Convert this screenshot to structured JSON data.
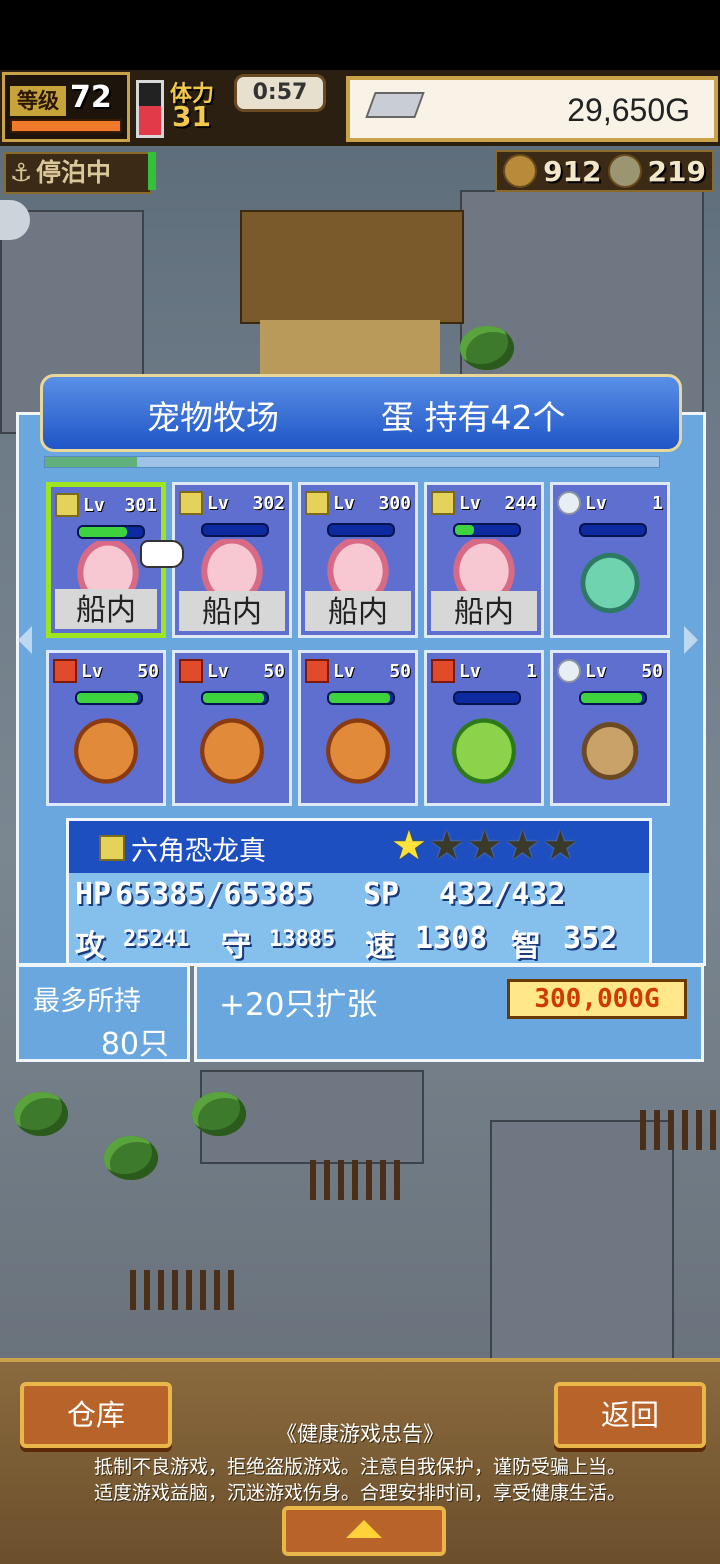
{
  "hud": {
    "level_label": "等级",
    "level": "72",
    "energy_label": "体力",
    "energy": "31",
    "timer": "0:57",
    "gold": "29,650G",
    "dock_status": "停泊中",
    "resource_1": "912",
    "resource_2": "219",
    "stamina_level": 0.55
  },
  "panel": {
    "title": "宠物牧场",
    "eggs": "蛋 持有42个",
    "progress": 0.15
  },
  "pets": [
    {
      "element": "thunder",
      "level": "301",
      "status": "船内",
      "hp": 0.75,
      "sprite": "axolotl",
      "selected": true
    },
    {
      "element": "thunder",
      "level": "302",
      "status": "船内",
      "hp": 0.0,
      "sprite": "axolotl"
    },
    {
      "element": "thunder",
      "level": "300",
      "status": "船内",
      "hp": 0.0,
      "sprite": "axolotl"
    },
    {
      "element": "thunder",
      "level": "244",
      "status": "船内",
      "hp": 0.3,
      "sprite": "axolotl"
    },
    {
      "element": "wind",
      "level": "1",
      "status": "",
      "hp": 0.0,
      "sprite": "mint"
    },
    {
      "element": "fire",
      "level": "50",
      "status": "",
      "hp": 0.95,
      "sprite": "dragon"
    },
    {
      "element": "fire",
      "level": "50",
      "status": "",
      "hp": 0.95,
      "sprite": "dragon"
    },
    {
      "element": "fire",
      "level": "50",
      "status": "",
      "hp": 0.95,
      "sprite": "dragon"
    },
    {
      "element": "fire",
      "level": "1",
      "status": "",
      "hp": 0.0,
      "sprite": "frog"
    },
    {
      "element": "wind",
      "level": "50",
      "status": "",
      "hp": 0.95,
      "sprite": "dino"
    }
  ],
  "lv_label": "Lv",
  "info": {
    "name": "六角恐龙真",
    "stars_filled": 1,
    "stars_total": 5,
    "hp_label": "HP",
    "hp": "65385/65385",
    "sp_label": "SP",
    "sp": "432/432",
    "atk_label": "攻",
    "atk": "25241",
    "def_label": "守",
    "def": "13885",
    "spd_label": "速",
    "spd": "1308",
    "int_label": "智",
    "int": "352"
  },
  "capacity": {
    "label": "最多所持",
    "value": "80只",
    "expand_label": "+20只扩张",
    "expand_price": "300,000G"
  },
  "bottom": {
    "warehouse": "仓库",
    "back": "返回",
    "warning_title": "《健康游戏忠告》",
    "warning_line1": "抵制不良游戏，拒绝盗版游戏。注意自我保护，谨防受骗上当。",
    "warning_line2": "适度游戏益脑，沉迷游戏伤身。合理安排时间，享受健康生活。"
  },
  "icons": {
    "gold": "silver-bar-icon",
    "dock": "anchor-icon",
    "res1": "meat-icon",
    "res2": "coin-icon"
  }
}
